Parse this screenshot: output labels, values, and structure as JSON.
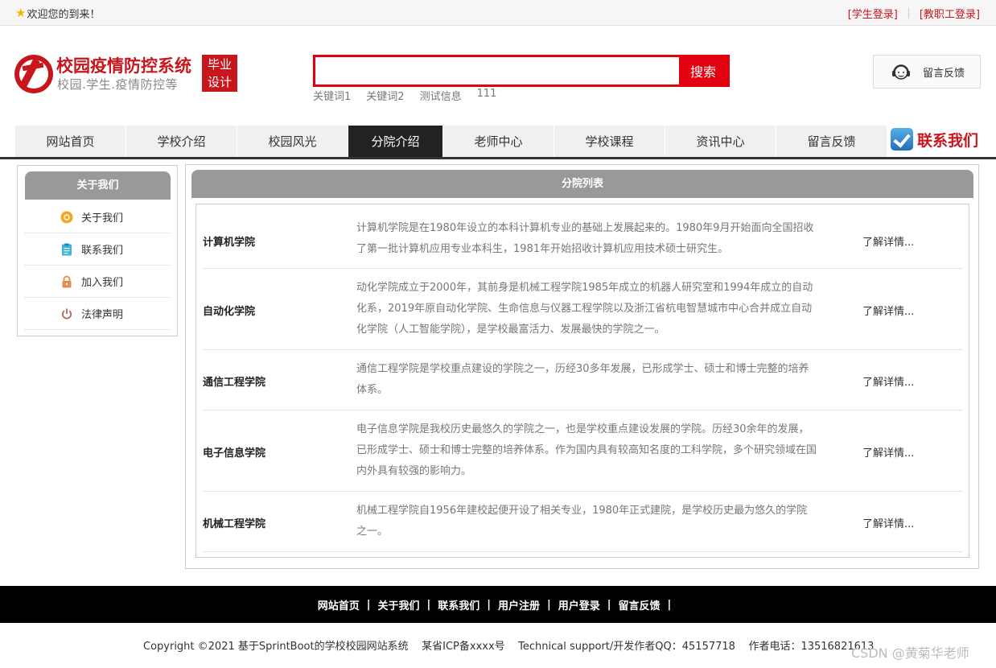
{
  "topbar": {
    "welcome": "欢迎您的到来！",
    "student_login": "[学生登录]",
    "staff_login": "[教职工登录]"
  },
  "logo": {
    "title": "校园疫情防控系统",
    "subtitle": "校园.学生.疫情防控等",
    "badge_line1": "毕业",
    "badge_line2": "设计"
  },
  "search": {
    "value": "",
    "placeholder": "",
    "button_label": "搜索",
    "keywords": [
      "关键词1",
      "关键词2",
      "测试信息",
      "111"
    ]
  },
  "feedback_button": {
    "label": "留言反馈",
    "icon": "customer-service-icon"
  },
  "nav": {
    "items": [
      "网站首页",
      "学校介绍",
      "校园风光",
      "分院介绍",
      "老师中心",
      "学校课程",
      "资讯中心",
      "留言反馈"
    ],
    "active": "分院介绍",
    "contact_label": "联系我们"
  },
  "sidebar": {
    "title": "关于我们",
    "items": [
      {
        "label": "关于我们",
        "icon": "info-circle-icon",
        "color": "#f5a623"
      },
      {
        "label": "联系我们",
        "icon": "clipboard-icon",
        "color": "#3ab6d8"
      },
      {
        "label": "加入我们",
        "icon": "lock-icon",
        "color": "#e88a4a"
      },
      {
        "label": "法律声明",
        "icon": "power-icon",
        "color": "#b06a5a"
      }
    ]
  },
  "main": {
    "title": "分院列表",
    "more_label": "了解详情...",
    "rows": [
      {
        "name": "计算机学院",
        "desc": "计算机学院是在1980年设立的本科计算机专业的基础上发展起来的。1980年9月开始面向全国招收了第一批计算机应用专业本科生，1981年开始招收计算机应用技术硕士研究生。"
      },
      {
        "name": "自动化学院",
        "desc": "动化学院成立于2000年，其前身是机械工程学院1985年成立的机器人研究室和1994年成立的自动化系，2019年原自动化学院、生命信息与仪器工程学院以及浙江省杭电智慧城市中心合并成立自动化学院（人工智能学院），是学校最富活力、发展最快的学院之一。"
      },
      {
        "name": "通信工程学院",
        "desc": "通信工程学院是学校重点建设的学院之一，历经30多年发展，已形成学士、硕士和博士完整的培养体系。"
      },
      {
        "name": "电子信息学院",
        "desc": "电子信息学院是我校历史最悠久的学院之一，也是学校重点建设发展的学院。历经30余年的发展，已形成学士、硕士和博士完整的培养体系。作为国内具有较高知名度的工科学院，多个研究领域在国内外具有较强的影响力。"
      },
      {
        "name": "机械工程学院",
        "desc": "机械工程学院自1956年建校起便开设了相关专业，1980年正式建院，是学校历史最为悠久的学院之一。"
      }
    ]
  },
  "footer": {
    "links": [
      "网站首页",
      "关于我们",
      "联系我们",
      "用户注册",
      "用户登录",
      "留言反馈"
    ],
    "separator": "|",
    "copyright": "Copyright ©2021 基于SprintBoot的学校校园网站系统    某省ICP备xxxx号    Technical support/开发作者QQ：45157718    作者电话：13516821613",
    "watermark": "CSDN @黄菊华老师"
  }
}
